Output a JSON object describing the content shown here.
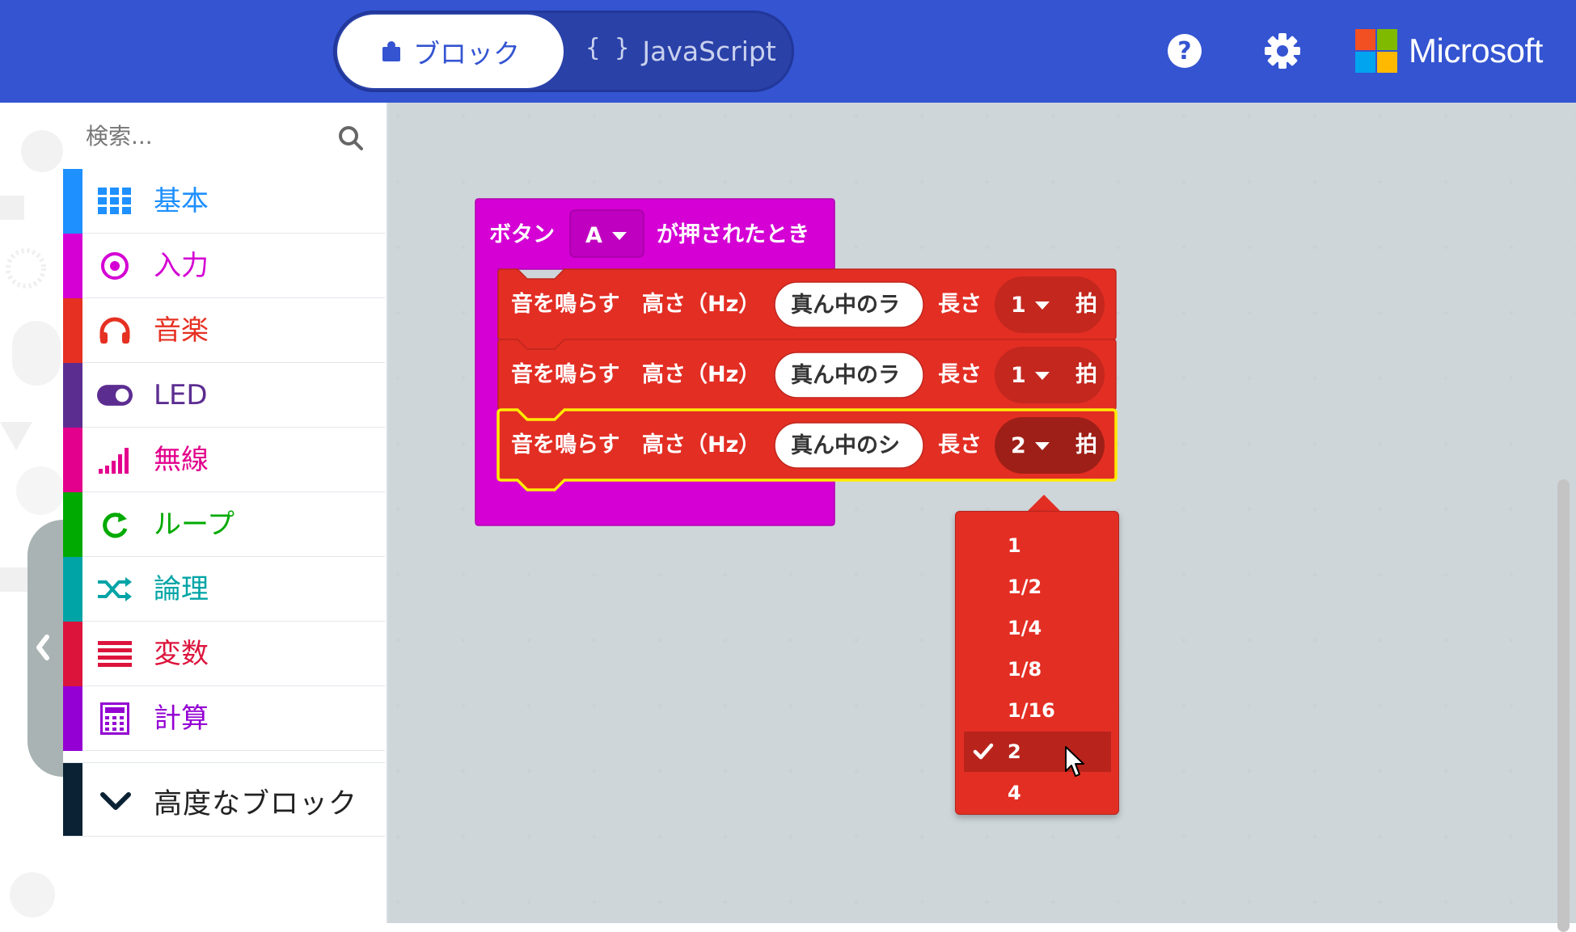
{
  "header": {
    "tab_blocks": "ブロック",
    "tab_javascript": "JavaScript",
    "js_braces": "{ }",
    "brand": "Microsoft",
    "icons": [
      "puzzle-icon",
      "braces-icon",
      "help-icon",
      "gear-icon",
      "microsoft-logo"
    ],
    "colors": {
      "bar": "#3454d1",
      "switch": "#2a41a8"
    }
  },
  "toolbox": {
    "search_placeholder": "検索...",
    "categories": [
      {
        "label": "基本",
        "color": "#1e90ff",
        "icon": "grid-icon"
      },
      {
        "label": "入力",
        "color": "#d400d4",
        "icon": "target-icon"
      },
      {
        "label": "音楽",
        "color": "#e63022",
        "icon": "headphones-icon"
      },
      {
        "label": "LED",
        "color": "#5c2d91",
        "icon": "toggle-icon"
      },
      {
        "label": "無線",
        "color": "#e3008c",
        "icon": "signal-icon"
      },
      {
        "label": "ループ",
        "color": "#00aa00",
        "icon": "loop-icon"
      },
      {
        "label": "論理",
        "color": "#00a4a6",
        "icon": "shuffle-icon"
      },
      {
        "label": "変数",
        "color": "#dc143c",
        "icon": "lines-icon"
      },
      {
        "label": "計算",
        "color": "#9400d3",
        "icon": "calculator-icon"
      }
    ],
    "advanced": "高度なブロック"
  },
  "blocks": {
    "event": {
      "prefix": "ボタン",
      "button": "A",
      "suffix": "が押されたとき",
      "color": "#d400d4"
    },
    "tones": [
      {
        "label": "音を鳴らす",
        "pitch_label": "高さ（Hz）",
        "note": "真ん中のラ",
        "len_label": "長さ",
        "beats": "1",
        "unit": "拍"
      },
      {
        "label": "音を鳴らす",
        "pitch_label": "高さ（Hz）",
        "note": "真ん中のラ",
        "len_label": "長さ",
        "beats": "1",
        "unit": "拍"
      },
      {
        "label": "音を鳴らす",
        "pitch_label": "高さ（Hz）",
        "note": "真ん中のシ",
        "len_label": "長さ",
        "beats": "2",
        "unit": "拍"
      }
    ],
    "tone_color": "#e32e24",
    "selected_outline": "#ffeb00"
  },
  "menu": {
    "options": [
      "1",
      "1/2",
      "1/4",
      "1/8",
      "1/16",
      "2",
      "4"
    ],
    "selected": "2"
  }
}
